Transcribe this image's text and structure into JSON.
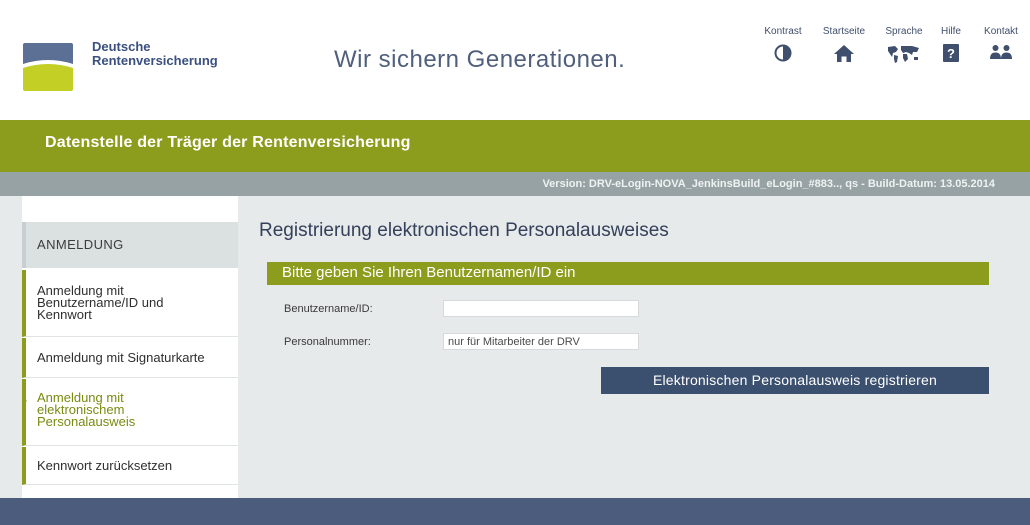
{
  "header": {
    "logo_line1": "Deutsche",
    "logo_line2": "Rentenversicherung",
    "slogan": "Wir sichern Generationen.",
    "nav": [
      {
        "label": "Kontrast",
        "icon": "contrast-icon"
      },
      {
        "label": "Startseite",
        "icon": "home-icon"
      },
      {
        "label": "Sprache",
        "icon": "world-map-icon"
      },
      {
        "label": "Hilfe",
        "icon": "help-icon"
      },
      {
        "label": "Kontakt",
        "icon": "contact-people-icon"
      }
    ]
  },
  "banner": {
    "title": "Datenstelle der Träger der Rentenversicherung",
    "version": "Version: DRV-eLogin-NOVA_JenkinsBuild_eLogin_#883.., qs - Build-Datum: 13.05.2014"
  },
  "sidebar": {
    "heading": "ANMELDUNG",
    "items": [
      {
        "line1": "Anmeldung mit",
        "line2": "Benutzername/ID und",
        "line3": "Kennwort"
      },
      {
        "line1": "Anmeldung mit Signaturkarte"
      },
      {
        "line1": "Anmeldung mit",
        "line2": "elektronischem",
        "line3": "Personalausweis"
      },
      {
        "line1": "Kennwort zurücksetzen"
      }
    ]
  },
  "main": {
    "title": "Registrierung elektronischen Personalausweises",
    "form_header": "Bitte geben Sie Ihren Benutzernamen/ID ein",
    "fields": {
      "username_label": "Benutzername/ID:",
      "username_value": "",
      "personnel_label": "Personalnummer:",
      "personnel_placeholder": "nur für Mitarbeiter der DRV"
    },
    "submit_label": "Elektronischen Personalausweis registrieren"
  },
  "colors": {
    "brand_green": "#8c9c1c",
    "brand_blue": "#3b4f6e",
    "header_text": "#3b5080"
  }
}
